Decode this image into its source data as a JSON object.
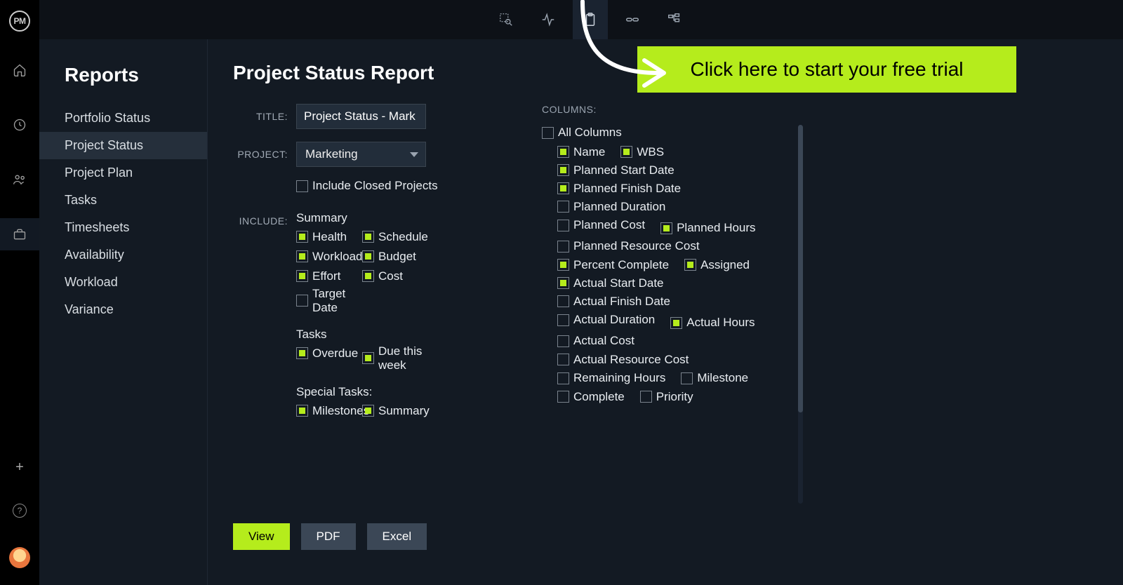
{
  "brand_logo_text": "PM",
  "cta_label": "Click here to start your free trial",
  "sidebar": {
    "title": "Reports",
    "items": [
      {
        "label": "Portfolio Status",
        "active": false
      },
      {
        "label": "Project Status",
        "active": true
      },
      {
        "label": "Project Plan",
        "active": false
      },
      {
        "label": "Tasks",
        "active": false
      },
      {
        "label": "Timesheets",
        "active": false
      },
      {
        "label": "Availability",
        "active": false
      },
      {
        "label": "Workload",
        "active": false
      },
      {
        "label": "Variance",
        "active": false
      }
    ]
  },
  "page": {
    "heading": "Project Status Report",
    "title_label": "TITLE:",
    "title_value": "Project Status - Mark",
    "project_label": "PROJECT:",
    "project_value": "Marketing",
    "include_closed_label": "Include Closed Projects",
    "include_closed_checked": false,
    "include_label": "INCLUDE:",
    "include_summary_heading": "Summary",
    "include_summary": [
      {
        "label": "Health",
        "checked": true
      },
      {
        "label": "Schedule",
        "checked": true,
        "box_only_row1": true
      },
      {
        "label": "Workload",
        "checked": true
      },
      {
        "label": "Budget",
        "checked": true
      },
      {
        "label": "Effort",
        "checked": true
      },
      {
        "label": "Cost",
        "checked": true
      },
      {
        "label": "Target Date",
        "checked": false
      }
    ],
    "include_tasks_heading": "Tasks",
    "include_tasks": [
      {
        "label": "Overdue",
        "checked": true
      },
      {
        "label": "Due this week",
        "checked": true
      }
    ],
    "include_special_heading": "Special Tasks:",
    "include_special": [
      {
        "label": "Milestones",
        "checked": true
      },
      {
        "label": "Summary",
        "checked": true
      }
    ],
    "columns_label": "COLUMNS:",
    "columns_all_label": "All Columns",
    "columns_all_checked": false,
    "columns": [
      {
        "label": "Name",
        "checked": true
      },
      {
        "label": "WBS",
        "checked": true
      },
      {
        "label": "Planned Start Date",
        "checked": true
      },
      {
        "label": "Planned Finish Date",
        "checked": true
      },
      {
        "label": "Planned Duration",
        "checked": false
      },
      {
        "label": "Planned Cost",
        "checked": false
      },
      {
        "label": "Planned Hours",
        "checked": true
      },
      {
        "label": "Planned Resource Cost",
        "checked": false
      },
      {
        "label": "Percent Complete",
        "checked": true
      },
      {
        "label": "Assigned",
        "checked": true
      },
      {
        "label": "Actual Start Date",
        "checked": true
      },
      {
        "label": "Actual Finish Date",
        "checked": false
      },
      {
        "label": "Actual Duration",
        "checked": false
      },
      {
        "label": "Actual Hours",
        "checked": true
      },
      {
        "label": "Actual Cost",
        "checked": false
      },
      {
        "label": "Actual Resource Cost",
        "checked": false
      },
      {
        "label": "Remaining Hours",
        "checked": false
      },
      {
        "label": "Milestone",
        "checked": false
      },
      {
        "label": "Complete",
        "checked": false
      },
      {
        "label": "Priority",
        "checked": false
      }
    ],
    "buttons": {
      "view": "View",
      "pdf": "PDF",
      "excel": "Excel"
    }
  }
}
